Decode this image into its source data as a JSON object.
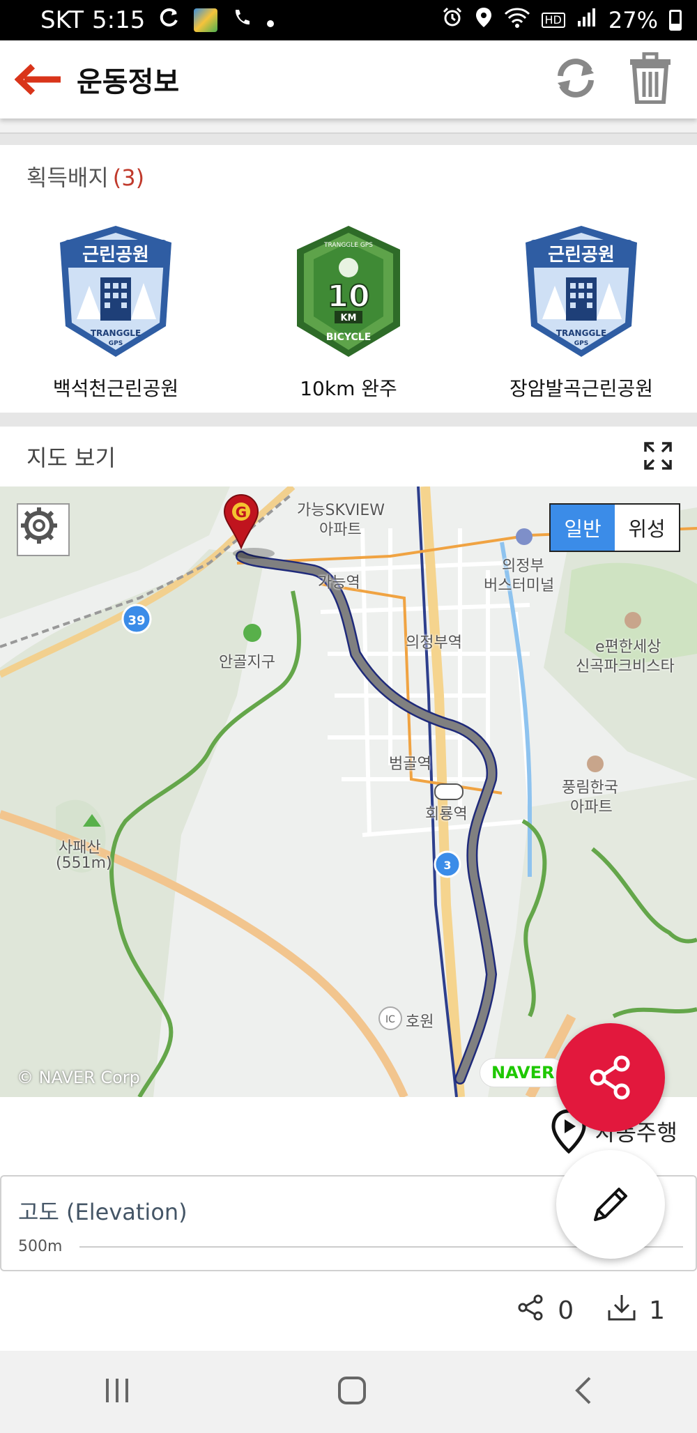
{
  "status_bar": {
    "carrier": "SKT",
    "time": "5:15",
    "battery_pct": "27%",
    "hd_label": "HD"
  },
  "app_bar": {
    "title": "운동정보"
  },
  "badges": {
    "title": "획득배지",
    "count": "(3)",
    "items": [
      {
        "label": "백석천근린공원",
        "emblem": "근린공원",
        "kind": "park"
      },
      {
        "label": "10km 완주",
        "emblem": "10",
        "kind": "bicycle"
      },
      {
        "label": "장암발곡근린공원",
        "emblem": "근린공원",
        "kind": "park"
      }
    ],
    "badge_texts": {
      "park_footer": "TRANGGLE",
      "park_footer2": "GPS",
      "bike_top": "TRANGGLE GPS",
      "bike_unit": "KM",
      "bike_bottom": "BICYCLE"
    }
  },
  "map_section": {
    "title": "지도 보기",
    "toggle": {
      "normal": "일반",
      "satellite": "위성",
      "selected": "일반"
    },
    "copyright": "© NAVER Corp",
    "naver_logo": "NAVER",
    "labels": {
      "l1": "가능SKVIEW",
      "l2": "아파트",
      "l3": "가능역",
      "l4": "의정부",
      "l5": "버스터미널",
      "l6": "의정부역",
      "l7": "안골지구",
      "l8": "e편한세상",
      "l9": "신곡파크비스타",
      "l10": "범골역",
      "l11": "회룡역",
      "l12": "풍림한국",
      "l13": "아파트",
      "l14": "사패산",
      "l15": "(551m)",
      "l16": "호원",
      "l17": "39",
      "l18": "3",
      "l19": "IC"
    },
    "start_marker": "G"
  },
  "autoplay": {
    "label": "자동주행"
  },
  "elevation": {
    "title": "고도 (Elevation)",
    "axis_label": "500m"
  },
  "counts": {
    "share": "0",
    "download": "1"
  },
  "colors": {
    "accent": "#e2183d",
    "back_arrow": "#d9341a",
    "toggle_on": "#3b8ce8",
    "route": "#808080"
  }
}
